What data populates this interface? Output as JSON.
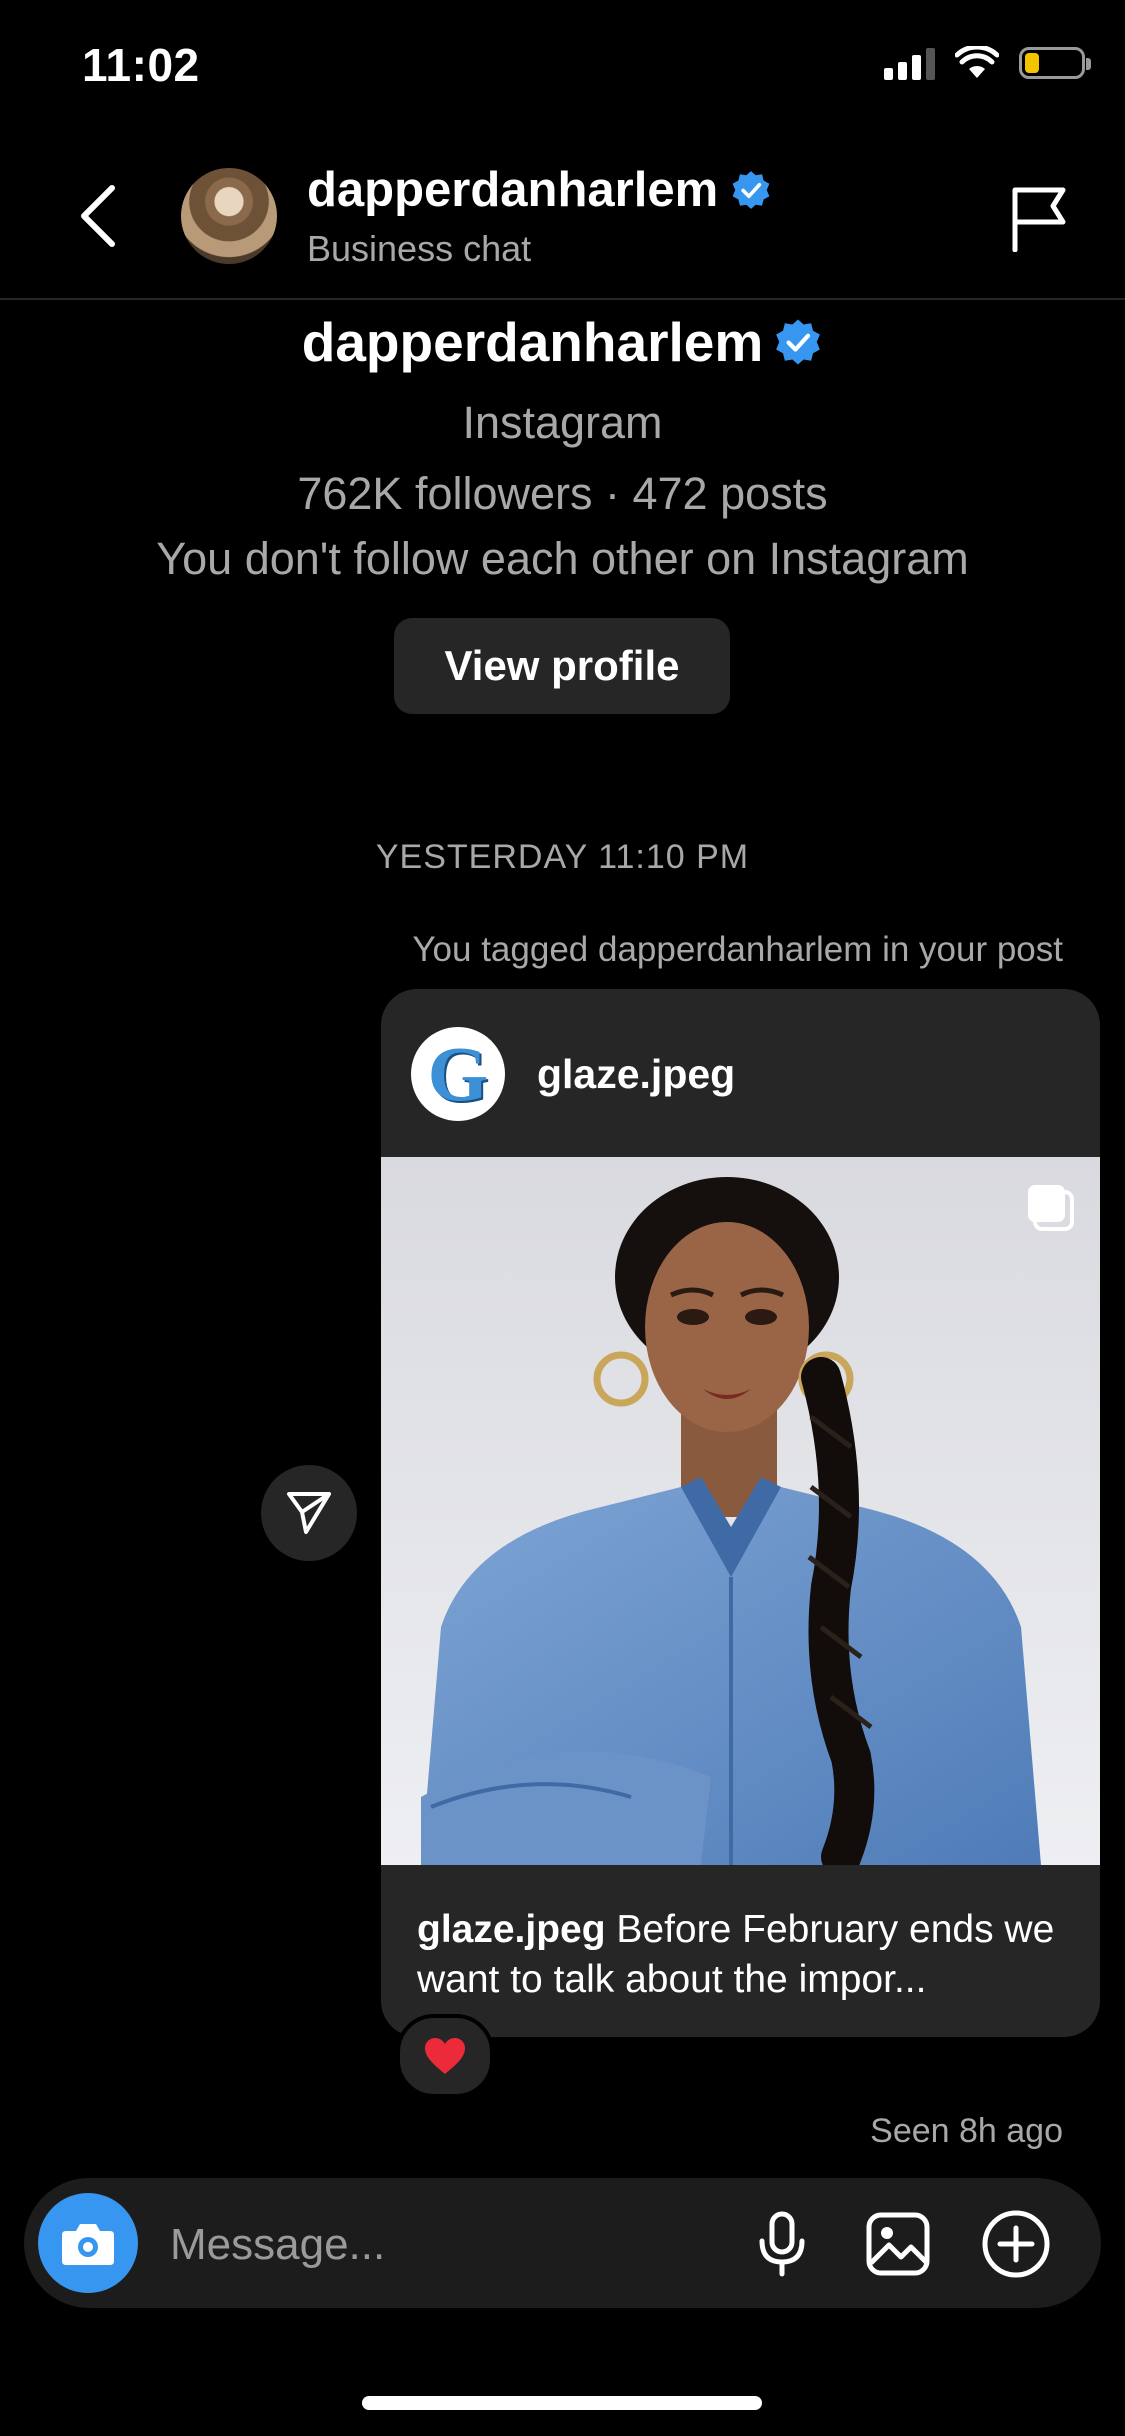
{
  "status_bar": {
    "time": "11:02"
  },
  "header": {
    "username": "dapperdanharlem",
    "subtitle": "Business chat",
    "verified": true
  },
  "profile": {
    "username": "dapperdanharlem",
    "platform": "Instagram",
    "stats": "762K followers · 472 posts",
    "relation": "You don't follow each other on Instagram",
    "view_profile_label": "View profile"
  },
  "thread": {
    "timestamp": "YESTERDAY 11:10 PM",
    "tag_note": "You tagged dapperdanharlem in your post",
    "post": {
      "author": "glaze.jpeg",
      "author_initial": "G",
      "caption_author": "glaze.jpeg",
      "caption_text": " Before February ends we want to talk about the impor..."
    },
    "reaction": "❤️",
    "seen": "Seen 8h ago"
  },
  "composer": {
    "placeholder": "Message..."
  },
  "colors": {
    "background": "#000000",
    "bubble": "#262626",
    "accent": "#3797f0",
    "verified": "#3797f0",
    "muted_text": "#a8a8a8"
  }
}
